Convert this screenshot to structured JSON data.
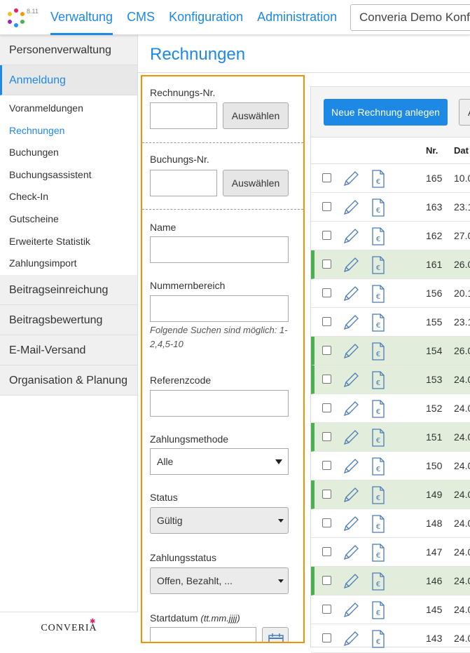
{
  "app": {
    "version": "8.11",
    "org_selector": "Converia Demo Konf",
    "brand": "CONVERIA"
  },
  "nav": {
    "items": [
      "Verwaltung",
      "CMS",
      "Konfiguration",
      "Administration"
    ]
  },
  "sidebar": {
    "sections": [
      "Personenverwaltung",
      "Anmeldung",
      "Beitragseinreichung",
      "Beitragsbewertung",
      "E-Mail-Versand",
      "Organisation & Planung"
    ],
    "sub_items": [
      "Voranmeldungen",
      "Rechnungen",
      "Buchungen",
      "Buchungsassistent",
      "Check-In",
      "Gutscheine",
      "Erweiterte Statistik",
      "Zahlungsimport"
    ]
  },
  "page": {
    "title": "Rechnungen"
  },
  "filters": {
    "rechnungs_nr": "Rechnungs-Nr.",
    "buchungs_nr": "Buchungs-Nr.",
    "pick_button": "Auswählen",
    "name": "Name",
    "nummernbereich": "Nummernbereich",
    "hint": "Folgende Suchen sind möglich: 1-2,4,5-10",
    "referenzcode": "Referenzcode",
    "zahlungsmethode": "Zahlungsmethode",
    "zahlungsmethode_value": "Alle",
    "status": "Status",
    "status_value": "Gültig",
    "zahlungsstatus": "Zahlungsstatus",
    "zahlungsstatus_value": "Offen, Bezahlt, ...",
    "startdatum": "Startdatum",
    "startdatum_format": "(tt.mm.jjjj)"
  },
  "table": {
    "new_button": "Neue Rechnung anlegen",
    "next_button": "A",
    "headers": {
      "nr": "Nr.",
      "datum": "Dat"
    },
    "rows": [
      {
        "nr": "165",
        "date": "10.0",
        "highlight": false
      },
      {
        "nr": "163",
        "date": "23.1",
        "highlight": false
      },
      {
        "nr": "162",
        "date": "27.0",
        "highlight": false
      },
      {
        "nr": "161",
        "date": "26.0",
        "highlight": true
      },
      {
        "nr": "156",
        "date": "20.1",
        "highlight": false
      },
      {
        "nr": "155",
        "date": "23.1",
        "highlight": false
      },
      {
        "nr": "154",
        "date": "26.0",
        "highlight": true
      },
      {
        "nr": "153",
        "date": "24.0",
        "highlight": true
      },
      {
        "nr": "152",
        "date": "24.0",
        "highlight": false
      },
      {
        "nr": "151",
        "date": "24.0",
        "highlight": true
      },
      {
        "nr": "150",
        "date": "24.0",
        "highlight": false
      },
      {
        "nr": "149",
        "date": "24.0",
        "highlight": true
      },
      {
        "nr": "148",
        "date": "24.0",
        "highlight": false
      },
      {
        "nr": "147",
        "date": "24.0",
        "highlight": false
      },
      {
        "nr": "146",
        "date": "24.0",
        "highlight": true
      },
      {
        "nr": "145",
        "date": "24.0",
        "highlight": false
      },
      {
        "nr": "143",
        "date": "24.0",
        "highlight": false
      }
    ]
  },
  "colors": {
    "accent": "#1e88e5",
    "panel_border": "#f39200",
    "row_highlight": "#e3eddc",
    "row_marker": "#4caf50"
  }
}
